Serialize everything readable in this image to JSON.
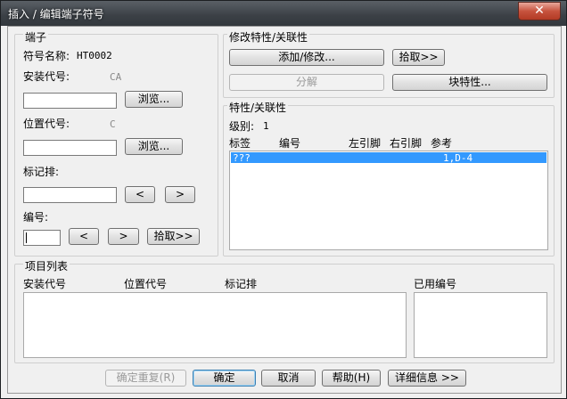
{
  "window": {
    "title": "插入 / 编辑端子符号",
    "close_glyph": "✕"
  },
  "terminal": {
    "group_title": "端子",
    "symbol_name_label": "符号名称:",
    "symbol_name_value": "HT0002",
    "install_code_label": "安装代号:",
    "install_code_hint": "CA",
    "install_code_value": "",
    "install_browse": "浏览...",
    "location_code_label": "位置代号:",
    "location_code_hint": "C",
    "location_code_value": "",
    "location_browse": "浏览...",
    "strip_label": "标记排:",
    "strip_value": "",
    "strip_prev": "<",
    "strip_next": ">",
    "number_label": "编号:",
    "number_value": "",
    "number_prev": "<",
    "number_next": ">",
    "pick_button": "拾取>>"
  },
  "modify": {
    "group_title": "修改特性/关联性",
    "add_modify_button": "添加/修改...",
    "pick_button": "拾取>>",
    "break_button": "分解",
    "block_props_button": "块特性..."
  },
  "props": {
    "group_title": "特性/关联性",
    "level_label": "级别:",
    "level_value": "1",
    "columns": [
      "标签",
      "编号",
      "左引脚",
      "右引脚",
      "参考"
    ],
    "rows": [
      {
        "tag": "???",
        "number": "",
        "left_pin": "",
        "right_pin": "",
        "ref": "1,D-4",
        "selected": true
      }
    ]
  },
  "items": {
    "group_title": "项目列表",
    "columns": [
      "安装代号",
      "位置代号",
      "标记排"
    ],
    "used_numbers_label": "已用编号"
  },
  "footer": {
    "confirm_repeat": "确定重复(R)",
    "ok": "确定",
    "cancel": "取消",
    "help": "帮助(H)",
    "details": "详细信息 >>"
  }
}
